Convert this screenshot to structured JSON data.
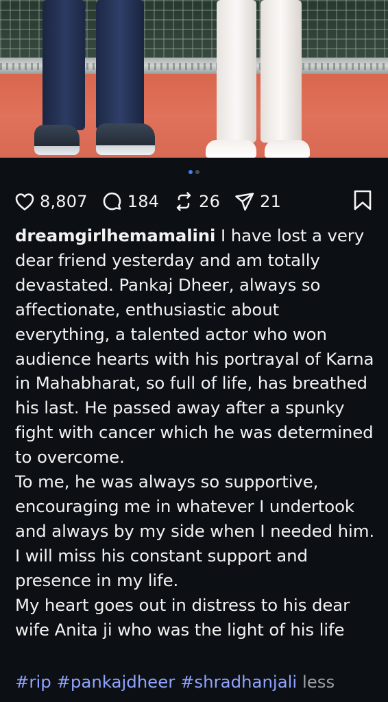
{
  "post": {
    "carousel": {
      "slide_count": 2,
      "active_index": 0
    },
    "actions": {
      "likes": "8,807",
      "comments": "184",
      "reposts": "26",
      "shares": "21"
    },
    "caption": {
      "username": "dreamgirlhemamalini",
      "paragraph1": "I have lost a very dear friend yesterday and am totally devastated. Pankaj Dheer, always so affectionate, enthusiastic about everything, a talented actor who won audience hearts with his portrayal of Karna in Mahabharat, so full of life,  has breathed his last. He passed away after a spunky fight with cancer which he was determined to overcome.",
      "paragraph2": "To me, he was always so supportive, encouraging me in whatever I undertook and always by my side when I needed him. I will miss his constant support and presence in my life.",
      "paragraph3": "My heart goes out in distress to his dear wife Anita ji who was the light of his life"
    },
    "hashtags": [
      "#rip",
      "#pankajdheer",
      "#shradhanjali"
    ],
    "less_label": "less"
  },
  "colors": {
    "background": "#0c1014",
    "hashtag": "#8fa3ff",
    "active_dot": "#3b82f6"
  },
  "icons": [
    "heart-icon",
    "comment-icon",
    "repost-icon",
    "share-icon",
    "bookmark-icon"
  ]
}
